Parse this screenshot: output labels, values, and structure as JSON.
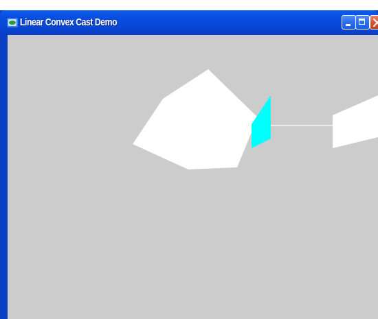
{
  "window": {
    "title": "Linear Convex Cast Demo",
    "icons": {
      "app": "app-icon",
      "minimize": "minimize-icon",
      "maximize": "maximize-icon",
      "close": "close-icon"
    }
  },
  "colors": {
    "titlebar": "#0a4fe0",
    "client_background": "#cccccc",
    "shape_fill": "#ffffff",
    "cast_hit_shape": "#00ffff",
    "cast_ray": "#ffffff"
  },
  "scene": {
    "description_labels": []
  }
}
